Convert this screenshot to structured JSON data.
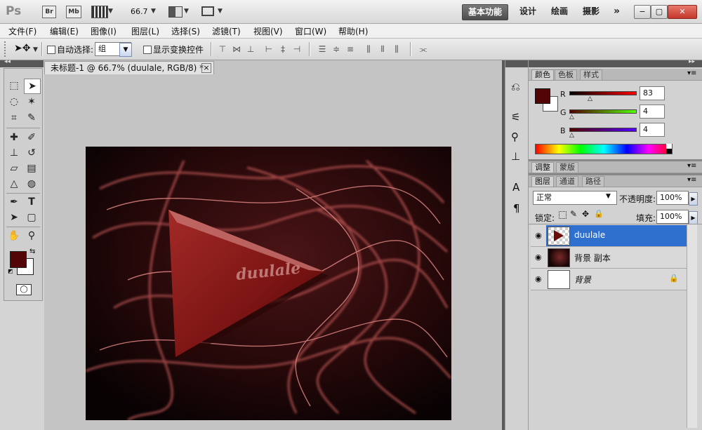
{
  "app": {
    "logo": "Ps",
    "br": "Br",
    "mb": "Mb",
    "zoom": "66.7"
  },
  "workspaces": [
    "基本功能",
    "设计",
    "绘画",
    "摄影",
    "»"
  ],
  "window_controls": [
    "−",
    "▢",
    "✕"
  ],
  "menu": [
    "文件(F)",
    "编辑(E)",
    "图像(I)",
    "图层(L)",
    "选择(S)",
    "滤镜(T)",
    "视图(V)",
    "窗口(W)",
    "帮助(H)"
  ],
  "options": {
    "auto_select": "自动选择:",
    "group_value": "组",
    "show_transform": "显示变换控件"
  },
  "document": {
    "tab_title": "未标题-1 @ 66.7% (duulale, RGB/8) *",
    "close": "×",
    "canvas_text": "duulale"
  },
  "color_panel": {
    "tabs": [
      "颜色",
      "色板",
      "样式"
    ],
    "r_label": "R",
    "g_label": "G",
    "b_label": "B",
    "r_value": "83",
    "g_value": "4",
    "b_value": "4",
    "foreground": "#530404",
    "background": "#ffffff"
  },
  "adjust_panel": {
    "tabs": [
      "调整",
      "蒙版"
    ]
  },
  "layers_panel": {
    "tabs": [
      "图层",
      "通道",
      "路径"
    ],
    "blend_mode": "正常",
    "opacity_label": "不透明度:",
    "opacity_value": "100%",
    "lock_label": "锁定:",
    "fill_label": "填充:",
    "fill_value": "100%",
    "layers": [
      {
        "name": "duulale",
        "selected": true
      },
      {
        "name": "背景 副本",
        "selected": false
      },
      {
        "name": "背景",
        "selected": false
      }
    ]
  },
  "colors": {
    "accent": "#2f6fce",
    "workspace_active": "#555555"
  }
}
